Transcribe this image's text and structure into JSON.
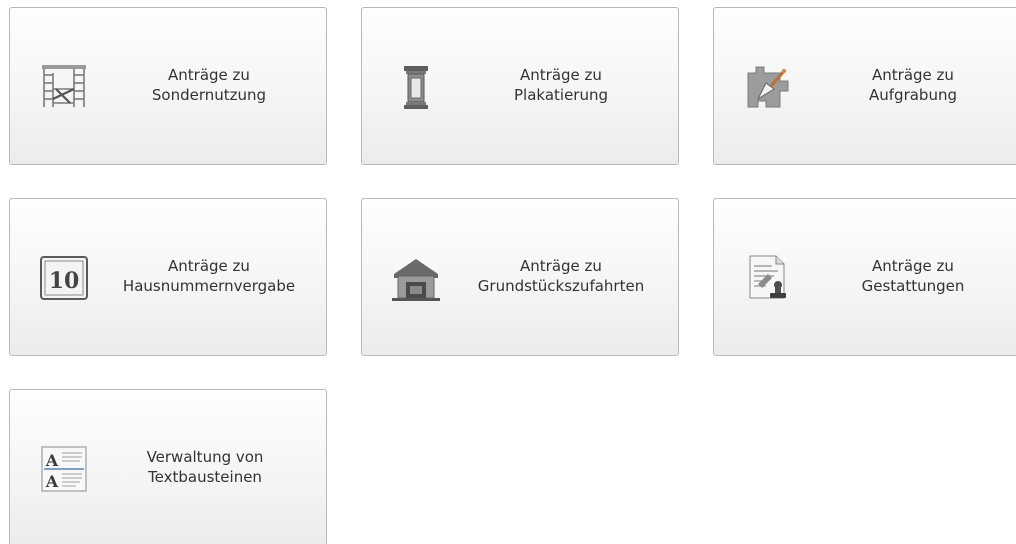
{
  "tiles": [
    {
      "id": "sondernutzung",
      "icon": "scaffold-icon",
      "line1": "Anträge zu",
      "line2": "Sondernutzung"
    },
    {
      "id": "plakatierung",
      "icon": "advertising-column-icon",
      "line1": "Anträge zu",
      "line2": "Plakatierung"
    },
    {
      "id": "aufgrabung",
      "icon": "trowel-icon",
      "line1": "Anträge zu",
      "line2": "Aufgrabung"
    },
    {
      "id": "hausnummernvergabe",
      "icon": "house-number-icon",
      "number": "10",
      "line1": "Anträge zu",
      "line2": "Hausnummernvergabe"
    },
    {
      "id": "grundstueckszufahrten",
      "icon": "garage-icon",
      "line1": "Anträge zu",
      "line2": "Grundstückszufahrten"
    },
    {
      "id": "gestattungen",
      "icon": "stamped-document-icon",
      "line1": "Anträge zu",
      "line2": "Gestattungen"
    },
    {
      "id": "textbausteine",
      "icon": "text-blocks-icon",
      "line1": "Verwaltung von",
      "line2": "Textbausteinen"
    }
  ]
}
